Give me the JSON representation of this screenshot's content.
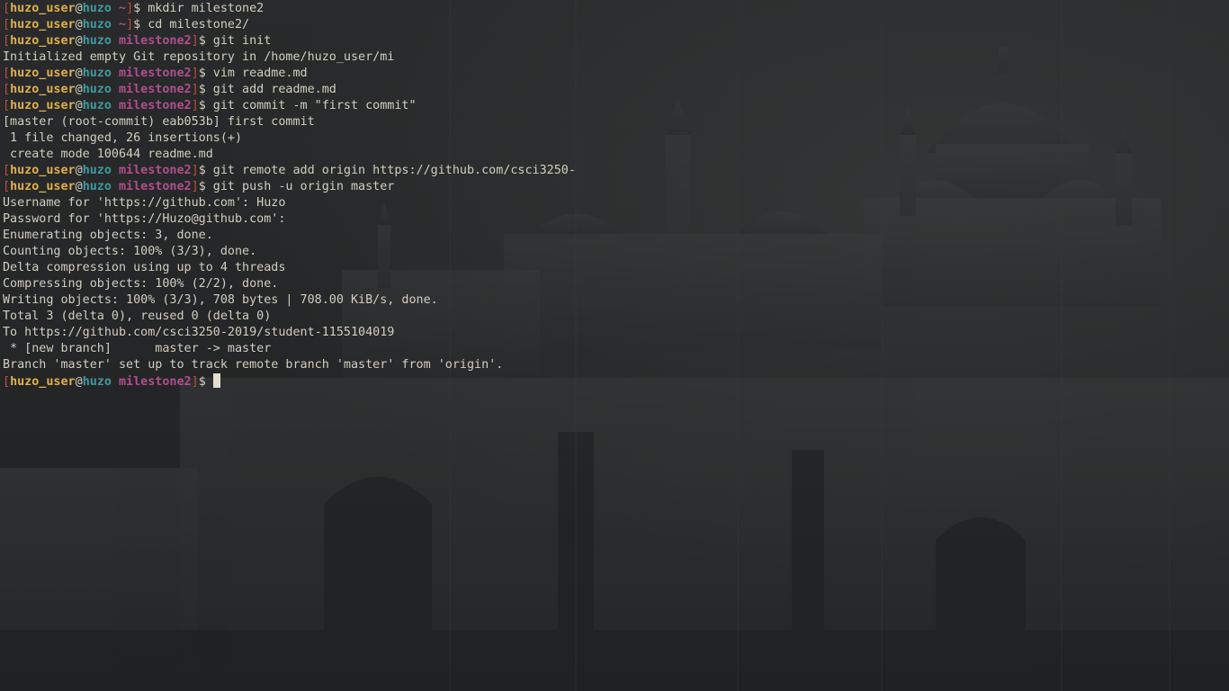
{
  "prompt": {
    "user": "huzo_user",
    "at": "@",
    "host": "huzo",
    "bracket_open": "[",
    "bracket_close": "]",
    "dollar": "$"
  },
  "lines": [
    {
      "kind": "prompt",
      "dir": "~",
      "cmd": " mkdir milestone2"
    },
    {
      "kind": "prompt",
      "dir": "~",
      "cmd": " cd milestone2/"
    },
    {
      "kind": "prompt",
      "dir": "milestone2",
      "cmd": " git init"
    },
    {
      "kind": "output",
      "text": "Initialized empty Git repository in /home/huzo_user/mi"
    },
    {
      "kind": "prompt",
      "dir": "milestone2",
      "cmd": " vim readme.md"
    },
    {
      "kind": "prompt",
      "dir": "milestone2",
      "cmd": " git add readme.md"
    },
    {
      "kind": "prompt",
      "dir": "milestone2",
      "cmd": " git commit -m \"first commit\""
    },
    {
      "kind": "output",
      "text": "[master (root-commit) eab053b] first commit"
    },
    {
      "kind": "output",
      "text": " 1 file changed, 26 insertions(+)"
    },
    {
      "kind": "output",
      "text": " create mode 100644 readme.md"
    },
    {
      "kind": "prompt",
      "dir": "milestone2",
      "cmd": " git remote add origin https://github.com/csci3250-"
    },
    {
      "kind": "prompt",
      "dir": "milestone2",
      "cmd": " git push -u origin master"
    },
    {
      "kind": "output",
      "text": "Username for 'https://github.com': Huzo"
    },
    {
      "kind": "output",
      "text": "Password for 'https://Huzo@github.com':"
    },
    {
      "kind": "output",
      "text": "Enumerating objects: 3, done."
    },
    {
      "kind": "output",
      "text": "Counting objects: 100% (3/3), done."
    },
    {
      "kind": "output",
      "text": "Delta compression using up to 4 threads"
    },
    {
      "kind": "output",
      "text": "Compressing objects: 100% (2/2), done."
    },
    {
      "kind": "output",
      "text": "Writing objects: 100% (3/3), 708 bytes | 708.00 KiB/s, done."
    },
    {
      "kind": "output",
      "text": "Total 3 (delta 0), reused 0 (delta 0)"
    },
    {
      "kind": "output",
      "text": "To https://github.com/csci3250-2019/student-1155104019"
    },
    {
      "kind": "output",
      "text": " * [new branch]      master -> master"
    },
    {
      "kind": "output",
      "text": "Branch 'master' set up to track remote branch 'master' from 'origin'."
    },
    {
      "kind": "active",
      "dir": "milestone2",
      "cmd": " "
    }
  ],
  "colors": {
    "bracket": "#c24b3a",
    "user": "#e1b04a",
    "host": "#3f9aa2",
    "dir": "#b04e8e",
    "text": "#d2cebf",
    "background": "#242627"
  },
  "wallpaper": "cathedral-silhouette"
}
